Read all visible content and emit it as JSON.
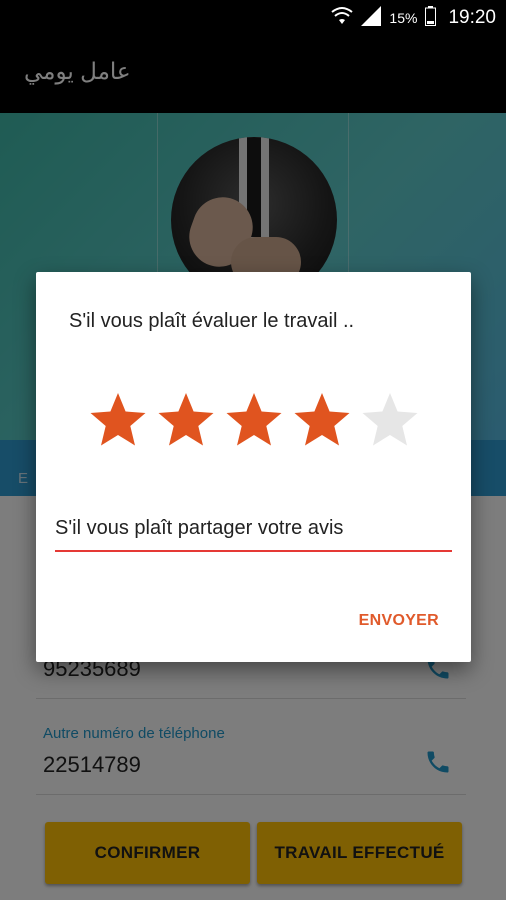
{
  "status_bar": {
    "battery_percent": "15%",
    "time": "19:20",
    "icons": [
      "wifi-icon",
      "signal-icon",
      "battery-icon"
    ]
  },
  "app_bar": {
    "title": "عامل يومي"
  },
  "profile": {
    "tab_text": "E"
  },
  "contact": {
    "phone_number": "95235689",
    "other_phone_label": "Autre numéro de téléphone",
    "other_phone_number": "22514789"
  },
  "actions": {
    "confirm_label": "CONFIRMER",
    "work_done_label": "TRAVAIL EFFECTUÉ"
  },
  "rating_dialog": {
    "title": "S'il vous plaît évaluer le travail ..",
    "rating": 4,
    "max_rating": 5,
    "review_placeholder": "S'il vous plaît partager votre avis",
    "send_label": "ENVOYER"
  },
  "colors": {
    "accent": "#e05a2b",
    "star_filled": "#e0541f",
    "star_empty": "#e6e6e6",
    "button": "#ffc107",
    "link_blue": "#2196c9"
  }
}
